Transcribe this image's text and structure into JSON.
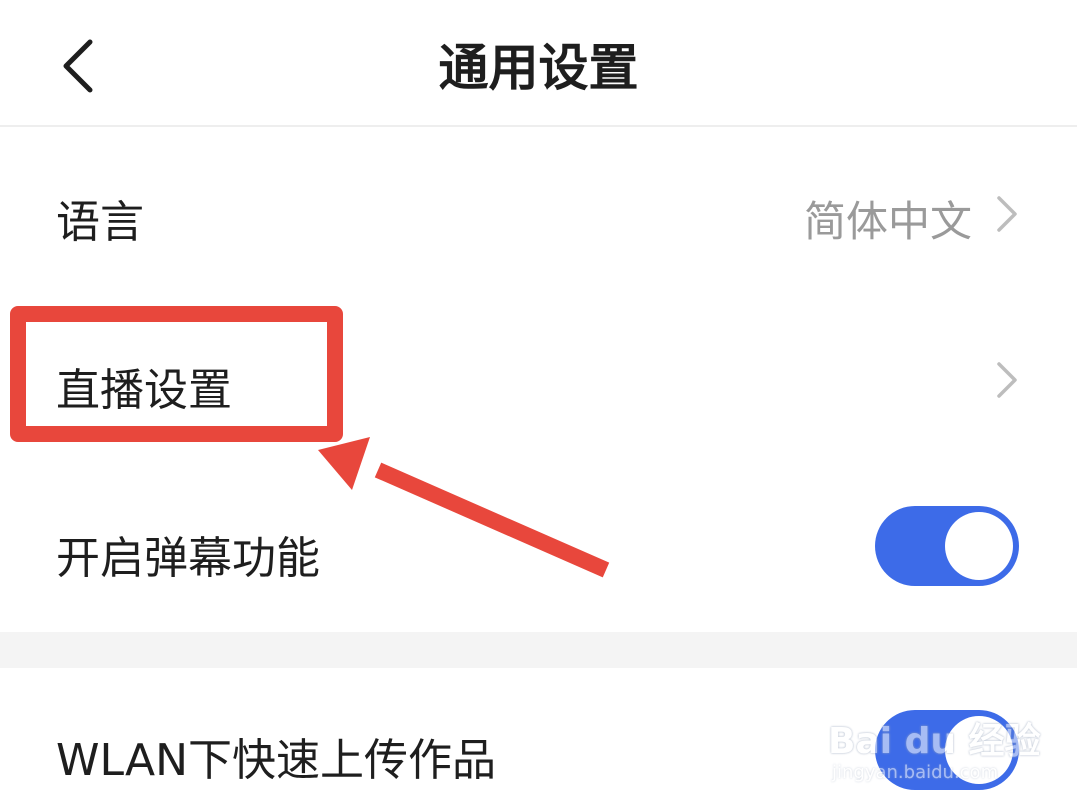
{
  "header": {
    "title": "通用设置",
    "back_icon": "chevron-left-icon"
  },
  "settings": {
    "language": {
      "label": "语言",
      "value": "简体中文"
    },
    "live": {
      "label": "直播设置"
    },
    "danmaku": {
      "label": "开启弹幕功能",
      "enabled": true
    },
    "wlan_upload": {
      "label": "WLAN下快速上传作品",
      "enabled": true
    }
  },
  "colors": {
    "accent": "#3d6be8",
    "annotation": "#e8473c",
    "secondary_text": "#9a9a9a",
    "divider": "#f4f4f4"
  },
  "watermark": {
    "logo": "Bai du 经验",
    "url": "jingyan.baidu.com"
  }
}
